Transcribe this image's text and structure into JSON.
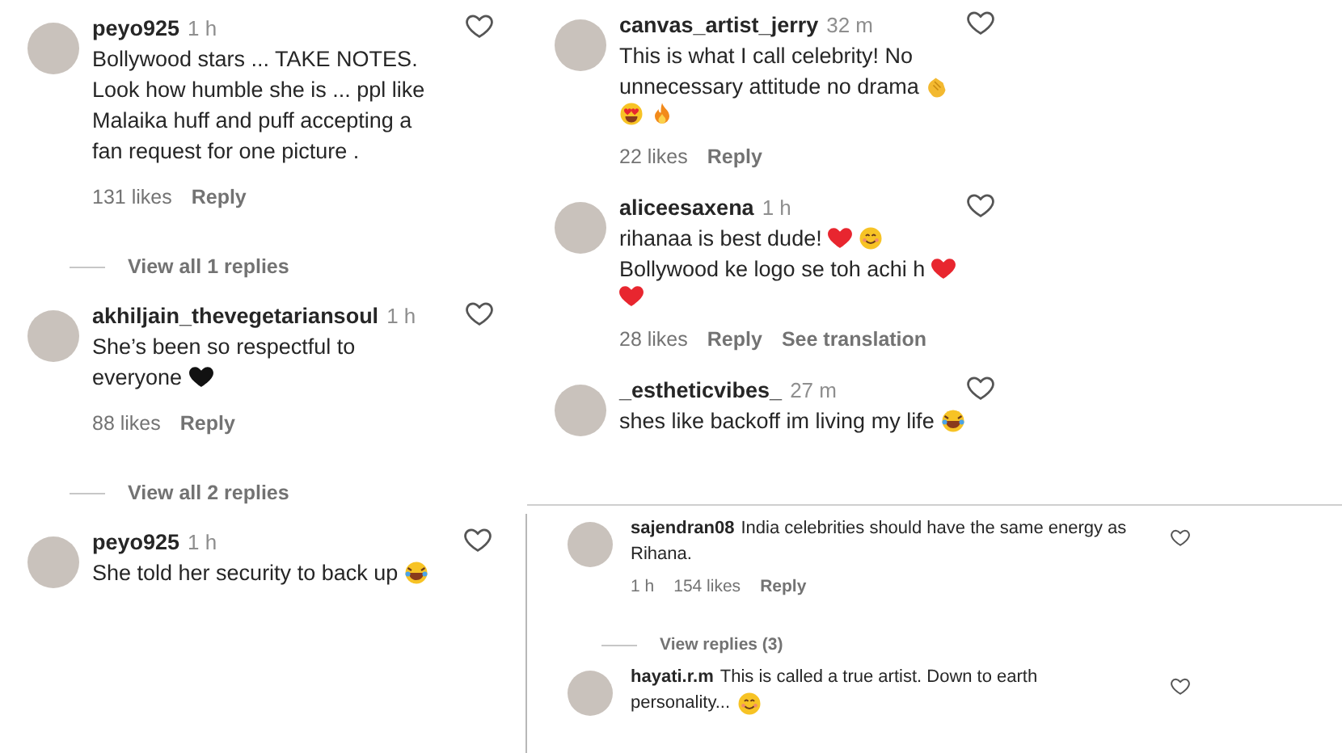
{
  "columns": [
    {
      "panels": [
        {
          "kind": "stacked",
          "comments": [
            {
              "user": "peyo925",
              "time": "1 h",
              "lines": [
                [
                  {
                    "kind": "text",
                    "text": "Bollywood stars ... TAKE NOTES."
                  }
                ],
                [
                  {
                    "kind": "text",
                    "text": "Look how humble she is ... ppl like"
                  }
                ],
                [
                  {
                    "kind": "text",
                    "text": "Malaika huff and puff accepting a"
                  }
                ],
                [
                  {
                    "kind": "text",
                    "text": "fan request for one picture ."
                  }
                ]
              ],
              "meta": [
                "131 likes",
                "Reply"
              ],
              "view_replies": "View all 1 replies"
            },
            {
              "user": "akhiljain_thevegetariansoul",
              "time": "1 h",
              "lines": [
                [
                  {
                    "kind": "text",
                    "text": "She’s been so respectful to"
                  }
                ],
                [
                  {
                    "kind": "text",
                    "text": "everyone"
                  },
                  {
                    "kind": "heart",
                    "color": "#111111"
                  }
                ]
              ],
              "meta": [
                "88 likes",
                "Reply"
              ],
              "view_replies": "View all 2 replies"
            }
          ]
        },
        {
          "kind": "stacked",
          "comments": [
            {
              "user": "peyo925",
              "time": "1 h",
              "lines": [
                [
                  {
                    "kind": "text",
                    "text": "She told her security to back up"
                  },
                  {
                    "kind": "laugh"
                  }
                ]
              ]
            }
          ]
        }
      ]
    },
    {
      "panels": [
        {
          "kind": "stacked",
          "comments": [
            {
              "user": "canvas_artist_jerry",
              "time": "32 m",
              "lines": [
                [
                  {
                    "kind": "text",
                    "text": "This is what I call celebrity! No"
                  }
                ],
                [
                  {
                    "kind": "text",
                    "text": "unnecessary attitude no drama"
                  },
                  {
                    "kind": "clap"
                  }
                ],
                [
                  {
                    "kind": "heart-eyes"
                  },
                  {
                    "kind": "fire"
                  }
                ]
              ],
              "meta": [
                "22 likes",
                "Reply"
              ]
            },
            {
              "user": "aliceesaxena",
              "time": "1 h",
              "lines": [
                [
                  {
                    "kind": "text",
                    "text": "rihanaa is best dude!"
                  },
                  {
                    "kind": "heart",
                    "color": "#e8262f"
                  },
                  {
                    "kind": "smile"
                  }
                ],
                [
                  {
                    "kind": "text",
                    "text": "Bollywood ke logo se toh achi h"
                  },
                  {
                    "kind": "heart",
                    "color": "#e8262f"
                  }
                ],
                [
                  {
                    "kind": "heart",
                    "color": "#e8262f"
                  }
                ]
              ],
              "meta": [
                "28 likes",
                "Reply",
                "See translation"
              ]
            },
            {
              "user": "_estheticvibes_",
              "time": "27 m",
              "lines": [
                [
                  {
                    "kind": "text",
                    "text": "shes like backoff im living my life"
                  },
                  {
                    "kind": "laugh"
                  }
                ]
              ]
            }
          ]
        },
        {
          "kind": "inline",
          "comments": [
            {
              "user": "sajendran08",
              "lines": [
                [
                  {
                    "kind": "text",
                    "text": "India celebrities should have the same energy as"
                  }
                ],
                [
                  {
                    "kind": "text",
                    "text": "Rihana."
                  }
                ]
              ],
              "meta": [
                "1 h",
                "154 likes",
                "Reply"
              ],
              "view_replies": "View replies (3)"
            },
            {
              "user": "hayati.r.m",
              "lines": [
                [
                  {
                    "kind": "text",
                    "text": "This is called a true artist. Down to earth"
                  }
                ],
                [
                  {
                    "kind": "text",
                    "text": "personality..."
                  },
                  {
                    "kind": "smile"
                  }
                ]
              ]
            }
          ]
        }
      ]
    }
  ]
}
